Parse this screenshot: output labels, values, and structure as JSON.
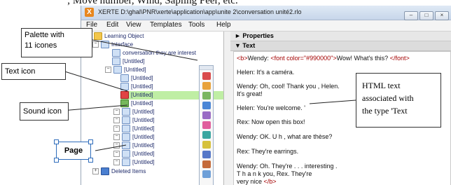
{
  "caption_top": "; Move number, Wind, Sapling Peer, etc.",
  "window": {
    "title": "XERTE D:\\ghal\\PNR\\xerte\\application\\app\\unite 2\\conversation unité2.rlo",
    "buttons": [
      "–",
      "□",
      "×"
    ]
  },
  "menu": [
    "File",
    "Edit",
    "View",
    "Templates",
    "Tools",
    "Help"
  ],
  "tree": {
    "root": "Learning Object",
    "interface": "Interface",
    "conversation": "conversation they are interest",
    "untitled": "[Untitled]",
    "deleted": "Deleted Items"
  },
  "palette": {
    "icon_count": 11,
    "icon_colors": [
      "#d94a4a",
      "#e8a23a",
      "#7bb661",
      "#4b86d6",
      "#9a6bc4",
      "#e05e9c",
      "#39a6a0",
      "#d6c13a",
      "#5577c8",
      "#c46a3a",
      "#6fa0d8"
    ]
  },
  "properties": {
    "header": "► Properties",
    "text_header": "▼ Text",
    "editor_lines": {
      "line1_open": "<b>",
      "line1_name": "Wendy: ",
      "line1_font": "<font color=\"#990000\">",
      "line1_text": "Wow! What's this? ",
      "line1_close": "</font>",
      "line2": "Helen: It's a caméra.",
      "line3a": "Wendy: Oh, cool! Thank you , Helen.",
      "line3b": "It's great!",
      "line4": "Helen: You're welcome. '",
      "line5": "Rex: Now open this box!",
      "line6": "Wendy: OK. U h , what are thèse?",
      "line7": "Rex:  They're earrings.",
      "line8a": "Wendy: Oh. They're . . . interesting .",
      "line8b": "T h a n k you, Rex. They're",
      "line8c_text": "very nice ",
      "line8c_close": "</b>"
    }
  },
  "annotations": {
    "palette": "Palette with\n11 icones",
    "text_icon": "Text icon",
    "sound_icon": "Sound icon",
    "page": "Page",
    "html_text": "HTML text\nassociated with\nthe type 'Text"
  }
}
